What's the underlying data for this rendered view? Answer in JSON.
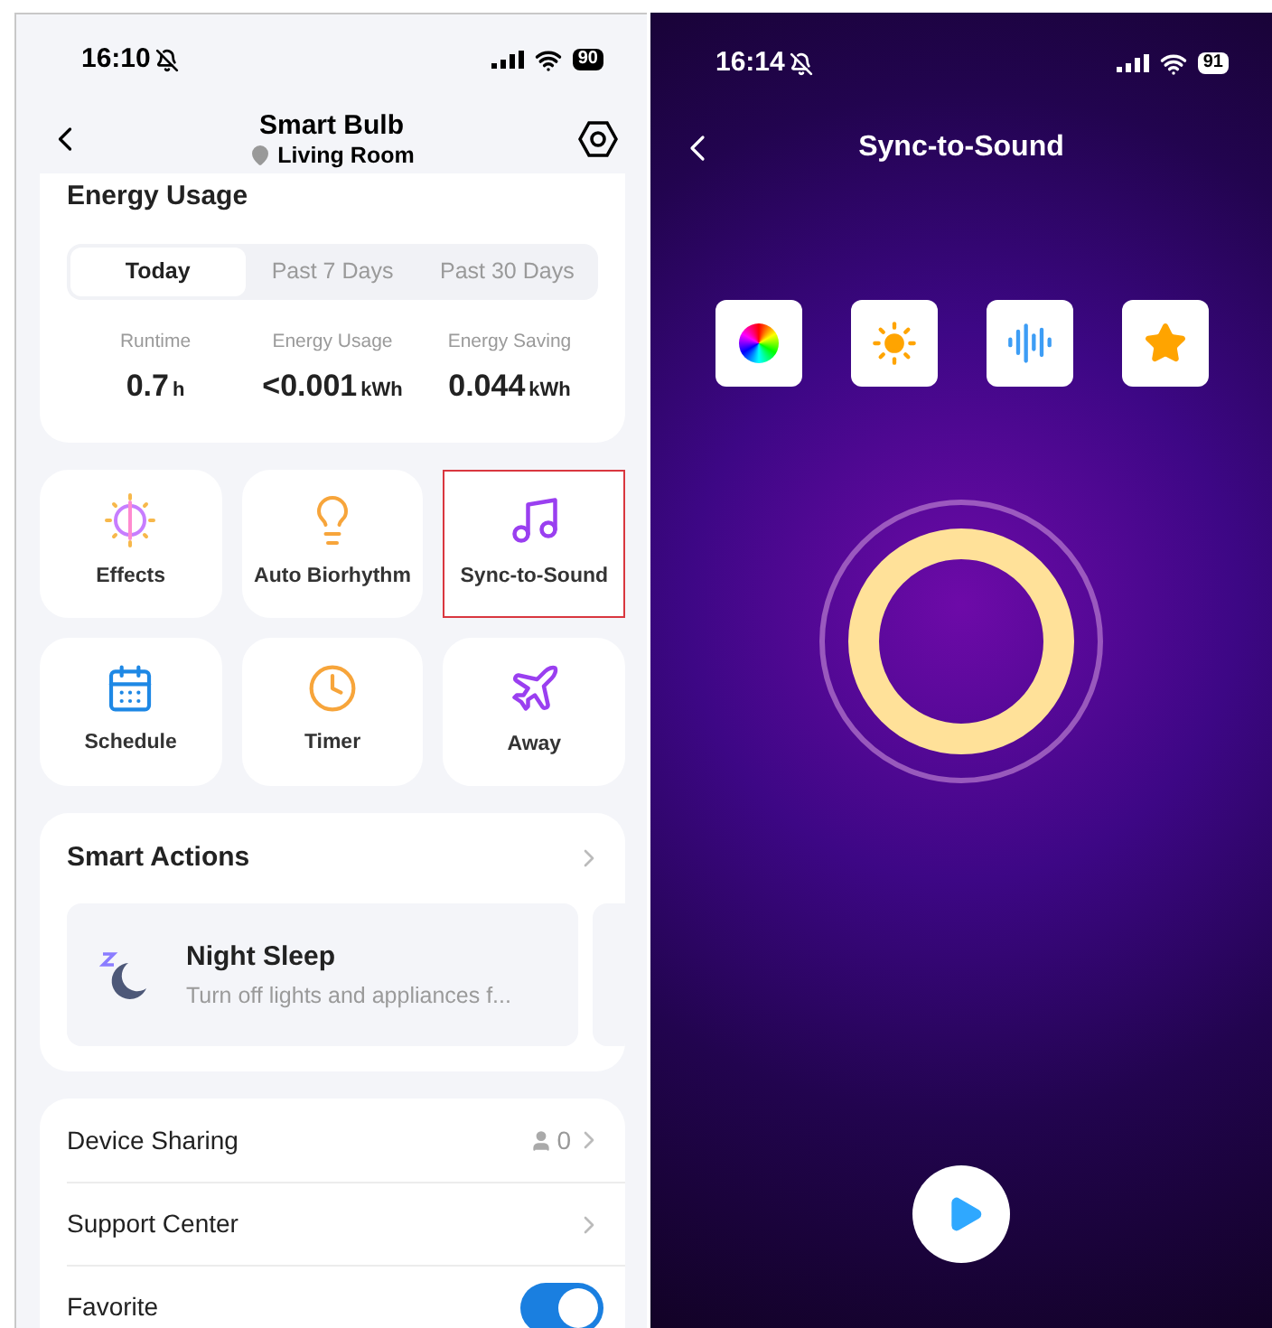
{
  "left_screen": {
    "status_bar": {
      "time": "16:10",
      "battery": "90"
    },
    "header": {
      "title": "Smart Bulb",
      "location": "Living Room"
    },
    "energy_usage": {
      "title": "Energy Usage",
      "tabs": [
        {
          "label": "Today",
          "selected": true
        },
        {
          "label": "Past 7 Days",
          "selected": false
        },
        {
          "label": "Past 30 Days",
          "selected": false
        }
      ],
      "stats": [
        {
          "label": "Runtime",
          "value": "0.7",
          "unit": "h"
        },
        {
          "label": "Energy Usage",
          "value": "<0.001",
          "unit": "kWh"
        },
        {
          "label": "Energy Saving",
          "value": "0.044",
          "unit": "kWh"
        }
      ]
    },
    "features": [
      {
        "kind": "effects",
        "label": "Effects",
        "highlighted": false
      },
      {
        "kind": "biorhythm",
        "label": "Auto Biorhythm",
        "highlighted": false
      },
      {
        "kind": "sound",
        "label": "Sync-to-Sound",
        "highlighted": true
      },
      {
        "kind": "schedule",
        "label": "Schedule",
        "highlighted": false
      },
      {
        "kind": "timer",
        "label": "Timer",
        "highlighted": false
      },
      {
        "kind": "away",
        "label": "Away",
        "highlighted": false
      }
    ],
    "smart_actions": {
      "title": "Smart Actions",
      "items": [
        {
          "title": "Night Sleep",
          "description": "Turn off lights and appliances f..."
        }
      ]
    },
    "settings": [
      {
        "kind": "link",
        "label": "Device Sharing",
        "count": "0"
      },
      {
        "kind": "link",
        "label": "Support Center"
      },
      {
        "kind": "toggle",
        "label": "Favorite",
        "on": true
      }
    ]
  },
  "right_screen": {
    "status_bar": {
      "time": "16:14",
      "battery": "91"
    },
    "title": "Sync-to-Sound",
    "modes": [
      {
        "kind": "color"
      },
      {
        "kind": "brightness"
      },
      {
        "kind": "waveform"
      },
      {
        "kind": "star"
      }
    ]
  }
}
